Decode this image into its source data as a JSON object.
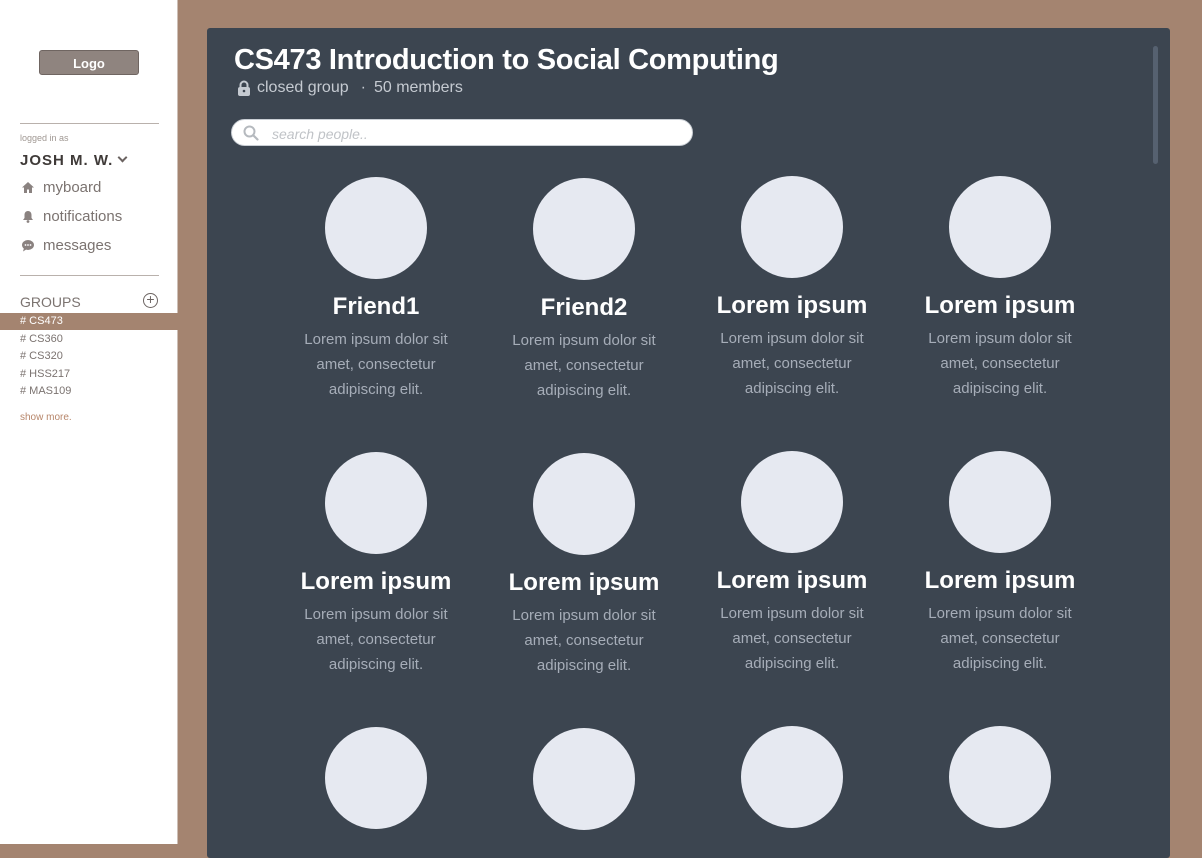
{
  "sidebar": {
    "logo_label": "Logo",
    "logged_in_label": "logged in as",
    "username": "JOSH M. W.",
    "nav": [
      {
        "icon": "home-icon",
        "label": "myboard"
      },
      {
        "icon": "bell-icon",
        "label": "notifications"
      },
      {
        "icon": "chat-icon",
        "label": "messages"
      }
    ],
    "groups_title": "GROUPS",
    "groups": [
      "# CS473",
      "# CS360",
      "# CS320",
      "# HSS217",
      "# MAS109"
    ],
    "active_group": "# CS473",
    "show_more": "show more."
  },
  "group": {
    "title": "CS473 Introduction to Social Computing",
    "privacy": "closed group",
    "separator": "·",
    "members": "50 members",
    "search_placeholder": "search people.."
  },
  "members": [
    {
      "name": "Friend1",
      "desc": "Lorem ipsum dolor sit amet, consectetur adipiscing elit."
    },
    {
      "name": "Friend2",
      "desc": "Lorem ipsum dolor sit amet, consectetur adipiscing elit."
    },
    {
      "name": "Lorem ipsum",
      "desc": "Lorem ipsum dolor sit amet, consectetur adipiscing elit."
    },
    {
      "name": "Lorem ipsum",
      "desc": "Lorem ipsum dolor sit amet, consectetur adipiscing elit."
    },
    {
      "name": "Lorem ipsum",
      "desc": "Lorem ipsum dolor sit amet, consectetur adipiscing elit."
    },
    {
      "name": "Lorem ipsum",
      "desc": "Lorem ipsum dolor sit amet, consectetur adipiscing elit."
    },
    {
      "name": "Lorem ipsum",
      "desc": "Lorem ipsum dolor sit amet, consectetur adipiscing elit."
    },
    {
      "name": "Lorem ipsum",
      "desc": "Lorem ipsum dolor sit amet, consectetur adipiscing elit."
    },
    {
      "name": "",
      "desc": ""
    },
    {
      "name": "",
      "desc": ""
    },
    {
      "name": "",
      "desc": ""
    },
    {
      "name": "",
      "desc": ""
    }
  ],
  "colors": {
    "background": "#a48470",
    "panel": "#3c4550",
    "avatar": "#e6e9f1",
    "active_group_bg": "#a48470"
  }
}
